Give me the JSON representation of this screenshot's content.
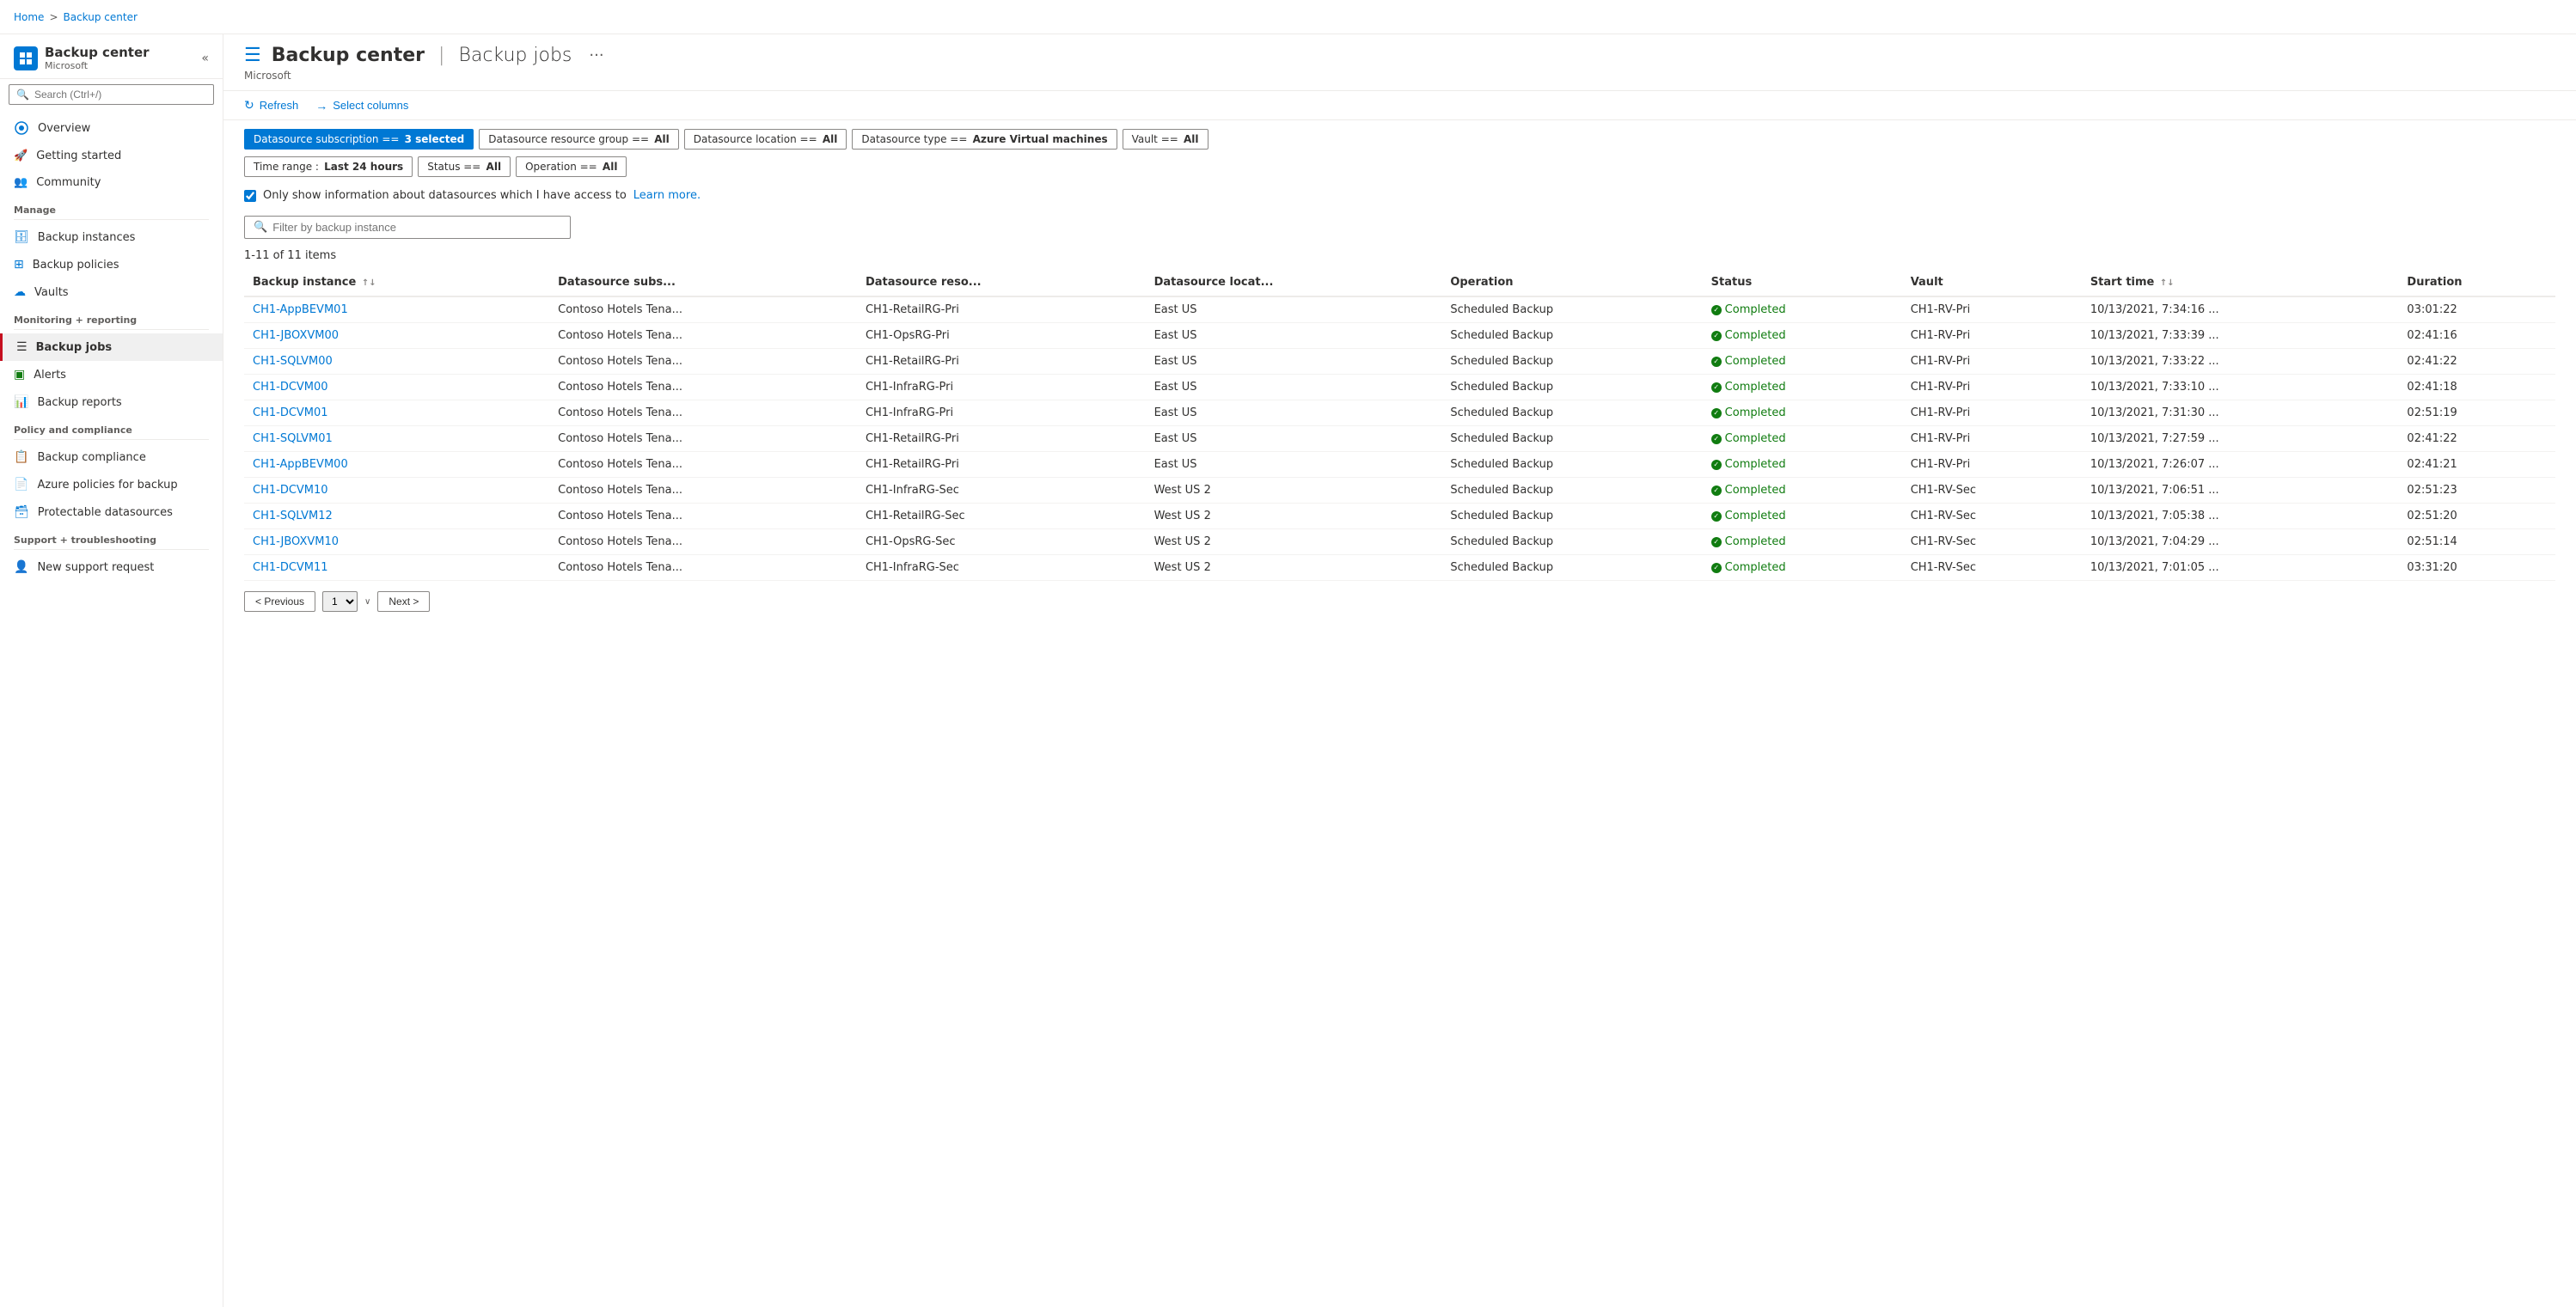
{
  "topbar": {
    "breadcrumbs": [
      {
        "label": "Home",
        "link": true
      },
      {
        "label": "Backup center",
        "link": true
      }
    ],
    "separator": ">"
  },
  "sidebar": {
    "app_title": "Backup center",
    "app_subtitle": "Microsoft",
    "search_placeholder": "Search (Ctrl+/)",
    "collapse_icon": "«",
    "more_icon": "···",
    "nav": [
      {
        "id": "overview",
        "label": "Overview",
        "icon": "grid",
        "section": null
      },
      {
        "id": "getting-started",
        "label": "Getting started",
        "icon": "rocket",
        "section": null
      },
      {
        "id": "community",
        "label": "Community",
        "icon": "people",
        "section": null
      },
      {
        "id": "manage",
        "label": "Manage",
        "section_header": true
      },
      {
        "id": "backup-instances",
        "label": "Backup instances",
        "icon": "db",
        "section": "Manage"
      },
      {
        "id": "backup-policies",
        "label": "Backup policies",
        "icon": "grid2",
        "section": "Manage"
      },
      {
        "id": "vaults",
        "label": "Vaults",
        "icon": "cloud",
        "section": "Manage"
      },
      {
        "id": "monitoring",
        "label": "Monitoring + reporting",
        "section_header": true
      },
      {
        "id": "backup-jobs",
        "label": "Backup jobs",
        "icon": "list",
        "section": "Monitoring",
        "active": true
      },
      {
        "id": "alerts",
        "label": "Alerts",
        "icon": "bell",
        "section": "Monitoring"
      },
      {
        "id": "backup-reports",
        "label": "Backup reports",
        "icon": "chart",
        "section": "Monitoring"
      },
      {
        "id": "policy-compliance",
        "label": "Policy and compliance",
        "section_header": true
      },
      {
        "id": "backup-compliance",
        "label": "Backup compliance",
        "icon": "shield",
        "section": "Policy"
      },
      {
        "id": "azure-policies",
        "label": "Azure policies for backup",
        "icon": "doc",
        "section": "Policy"
      },
      {
        "id": "protectable",
        "label": "Protectable datasources",
        "icon": "db2",
        "section": "Policy"
      },
      {
        "id": "support",
        "label": "Support + troubleshooting",
        "section_header": true
      },
      {
        "id": "new-support",
        "label": "New support request",
        "icon": "person",
        "section": "Support"
      }
    ]
  },
  "page": {
    "service": "Backup center",
    "title": "Backup center",
    "divider": "|",
    "subtitle": "Backup jobs",
    "more": "···",
    "ms_label": "Microsoft"
  },
  "toolbar": {
    "refresh_label": "Refresh",
    "columns_label": "Select columns"
  },
  "filters": {
    "pills": [
      {
        "id": "datasource-sub",
        "label": "Datasource subscription ==",
        "value": "3 selected",
        "active": true
      },
      {
        "id": "datasource-rg",
        "label": "Datasource resource group ==",
        "value": "All",
        "active": false
      },
      {
        "id": "datasource-loc",
        "label": "Datasource location ==",
        "value": "All",
        "active": false
      },
      {
        "id": "datasource-type",
        "label": "Datasource type ==",
        "value": "Azure Virtual machines",
        "active": false
      },
      {
        "id": "vault",
        "label": "Vault ==",
        "value": "All",
        "active": false
      },
      {
        "id": "time-range",
        "label": "Time range :",
        "value": "Last 24 hours",
        "active": false
      },
      {
        "id": "status",
        "label": "Status ==",
        "value": "All",
        "active": false
      },
      {
        "id": "operation",
        "label": "Operation ==",
        "value": "All",
        "active": false
      }
    ]
  },
  "checkbox": {
    "checked": true,
    "label": "Only show information about datasources which I have access to",
    "link_text": "Learn more.",
    "link_url": "#"
  },
  "search_filter": {
    "placeholder": "Filter by backup instance"
  },
  "count": {
    "text": "1-11 of 11 items"
  },
  "table": {
    "columns": [
      {
        "id": "backup-instance",
        "label": "Backup instance",
        "sortable": true
      },
      {
        "id": "datasource-subs",
        "label": "Datasource subs...",
        "sortable": false
      },
      {
        "id": "datasource-reso",
        "label": "Datasource reso...",
        "sortable": false
      },
      {
        "id": "datasource-locat",
        "label": "Datasource locat...",
        "sortable": false
      },
      {
        "id": "operation",
        "label": "Operation",
        "sortable": false
      },
      {
        "id": "status",
        "label": "Status",
        "sortable": false
      },
      {
        "id": "vault",
        "label": "Vault",
        "sortable": false
      },
      {
        "id": "start-time",
        "label": "Start time",
        "sortable": true
      },
      {
        "id": "duration",
        "label": "Duration",
        "sortable": false
      }
    ],
    "rows": [
      {
        "backup_instance": "CH1-AppBEVM01",
        "datasource_subs": "Contoso Hotels Tena...",
        "datasource_reso": "CH1-RetailRG-Pri",
        "datasource_locat": "East US",
        "operation": "Scheduled Backup",
        "status": "Completed",
        "vault": "CH1-RV-Pri",
        "start_time": "10/13/2021, 7:34:16 ...",
        "duration": "03:01:22"
      },
      {
        "backup_instance": "CH1-JBOXVM00",
        "datasource_subs": "Contoso Hotels Tena...",
        "datasource_reso": "CH1-OpsRG-Pri",
        "datasource_locat": "East US",
        "operation": "Scheduled Backup",
        "status": "Completed",
        "vault": "CH1-RV-Pri",
        "start_time": "10/13/2021, 7:33:39 ...",
        "duration": "02:41:16"
      },
      {
        "backup_instance": "CH1-SQLVM00",
        "datasource_subs": "Contoso Hotels Tena...",
        "datasource_reso": "CH1-RetailRG-Pri",
        "datasource_locat": "East US",
        "operation": "Scheduled Backup",
        "status": "Completed",
        "vault": "CH1-RV-Pri",
        "start_time": "10/13/2021, 7:33:22 ...",
        "duration": "02:41:22"
      },
      {
        "backup_instance": "CH1-DCVM00",
        "datasource_subs": "Contoso Hotels Tena...",
        "datasource_reso": "CH1-InfraRG-Pri",
        "datasource_locat": "East US",
        "operation": "Scheduled Backup",
        "status": "Completed",
        "vault": "CH1-RV-Pri",
        "start_time": "10/13/2021, 7:33:10 ...",
        "duration": "02:41:18"
      },
      {
        "backup_instance": "CH1-DCVM01",
        "datasource_subs": "Contoso Hotels Tena...",
        "datasource_reso": "CH1-InfraRG-Pri",
        "datasource_locat": "East US",
        "operation": "Scheduled Backup",
        "status": "Completed",
        "vault": "CH1-RV-Pri",
        "start_time": "10/13/2021, 7:31:30 ...",
        "duration": "02:51:19"
      },
      {
        "backup_instance": "CH1-SQLVM01",
        "datasource_subs": "Contoso Hotels Tena...",
        "datasource_reso": "CH1-RetailRG-Pri",
        "datasource_locat": "East US",
        "operation": "Scheduled Backup",
        "status": "Completed",
        "vault": "CH1-RV-Pri",
        "start_time": "10/13/2021, 7:27:59 ...",
        "duration": "02:41:22"
      },
      {
        "backup_instance": "CH1-AppBEVM00",
        "datasource_subs": "Contoso Hotels Tena...",
        "datasource_reso": "CH1-RetailRG-Pri",
        "datasource_locat": "East US",
        "operation": "Scheduled Backup",
        "status": "Completed",
        "vault": "CH1-RV-Pri",
        "start_time": "10/13/2021, 7:26:07 ...",
        "duration": "02:41:21"
      },
      {
        "backup_instance": "CH1-DCVM10",
        "datasource_subs": "Contoso Hotels Tena...",
        "datasource_reso": "CH1-InfraRG-Sec",
        "datasource_locat": "West US 2",
        "operation": "Scheduled Backup",
        "status": "Completed",
        "vault": "CH1-RV-Sec",
        "start_time": "10/13/2021, 7:06:51 ...",
        "duration": "02:51:23"
      },
      {
        "backup_instance": "CH1-SQLVM12",
        "datasource_subs": "Contoso Hotels Tena...",
        "datasource_reso": "CH1-RetailRG-Sec",
        "datasource_locat": "West US 2",
        "operation": "Scheduled Backup",
        "status": "Completed",
        "vault": "CH1-RV-Sec",
        "start_time": "10/13/2021, 7:05:38 ...",
        "duration": "02:51:20"
      },
      {
        "backup_instance": "CH1-JBOXVM10",
        "datasource_subs": "Contoso Hotels Tena...",
        "datasource_reso": "CH1-OpsRG-Sec",
        "datasource_locat": "West US 2",
        "operation": "Scheduled Backup",
        "status": "Completed",
        "vault": "CH1-RV-Sec",
        "start_time": "10/13/2021, 7:04:29 ...",
        "duration": "02:51:14"
      },
      {
        "backup_instance": "CH1-DCVM11",
        "datasource_subs": "Contoso Hotels Tena...",
        "datasource_reso": "CH1-InfraRG-Sec",
        "datasource_locat": "West US 2",
        "operation": "Scheduled Backup",
        "status": "Completed",
        "vault": "CH1-RV-Sec",
        "start_time": "10/13/2021, 7:01:05 ...",
        "duration": "03:31:20"
      }
    ]
  },
  "pagination": {
    "prev_label": "< Previous",
    "page_num": "1",
    "next_label": "Next >"
  }
}
